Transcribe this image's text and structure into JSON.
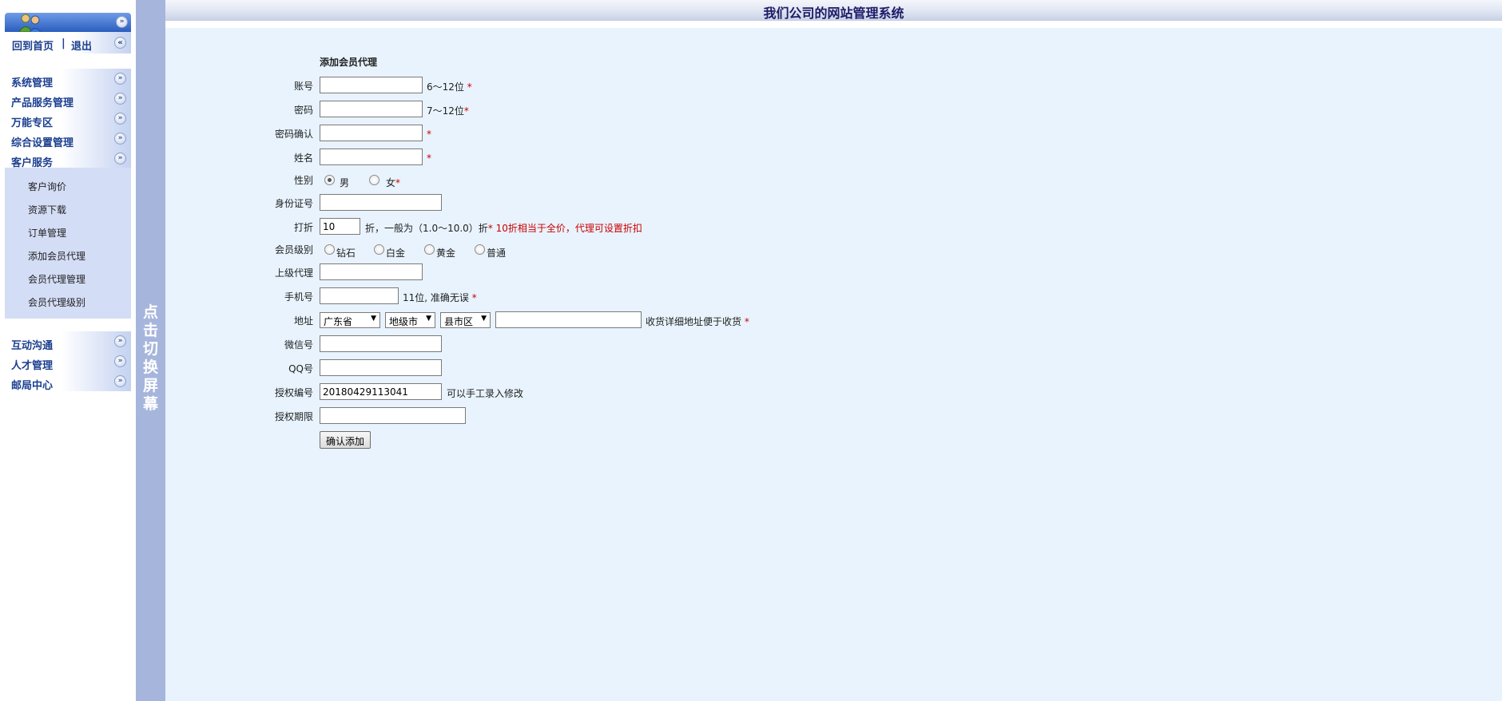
{
  "app": {
    "title": "我们公司的网站管理系统"
  },
  "sidebar": {
    "quick_links": [
      "回到首页",
      "|",
      "退出"
    ],
    "groups_top": [
      "系统管理",
      "产品服务管理",
      "万能专区",
      "综合设置管理",
      "客户服务"
    ],
    "sub_items": [
      "客户询价",
      "资源下载",
      "订单管理",
      "添加会员代理",
      "会员代理管理",
      "会员代理级别"
    ],
    "groups_bottom": [
      "互动沟通",
      "人才管理",
      "邮局中心"
    ]
  },
  "toggle": {
    "text": [
      "点",
      "击",
      "切",
      "换",
      "屏",
      "幕"
    ]
  },
  "form": {
    "heading": "添加会员代理",
    "account": {
      "label": "账号",
      "value": "",
      "hint": "6～12位",
      "required": "*"
    },
    "password": {
      "label": "密码",
      "value": "",
      "hint": "7～12位",
      "required": "*"
    },
    "confirm": {
      "label": "密码确认",
      "value": "",
      "required": "*"
    },
    "name": {
      "label": "姓名",
      "value": "",
      "required": "*"
    },
    "gender": {
      "label": "性别",
      "options": [
        "男",
        "女"
      ],
      "selected": "男",
      "required": "*"
    },
    "id_card": {
      "label": "身份证号",
      "value": ""
    },
    "discount": {
      "label": "打折",
      "value": "10",
      "hint": "折，一般为（1.0～10.0）折",
      "required": "*",
      "note": "10折相当于全价，代理可设置折扣"
    },
    "level": {
      "label": "会员级别",
      "options": [
        "钻石",
        "白金",
        "黄金",
        "普通"
      ]
    },
    "parent_agent": {
      "label": "上级代理",
      "value": ""
    },
    "phone": {
      "label": "手机号",
      "value": "",
      "hint": "11位, 准确无误",
      "required": "*"
    },
    "address": {
      "label": "地址",
      "province": "广东省",
      "city": "地级市",
      "district": "县市区",
      "detail": "",
      "hint": "收货详细地址便于收货",
      "required": "*"
    },
    "wechat": {
      "label": "微信号",
      "value": ""
    },
    "qq": {
      "label": "QQ号",
      "value": ""
    },
    "auth_no": {
      "label": "授权编号",
      "value": "20180429113041",
      "hint": "可以手工录入修改"
    },
    "auth_period": {
      "label": "授权期限",
      "value": ""
    },
    "submit_label": "确认添加"
  }
}
